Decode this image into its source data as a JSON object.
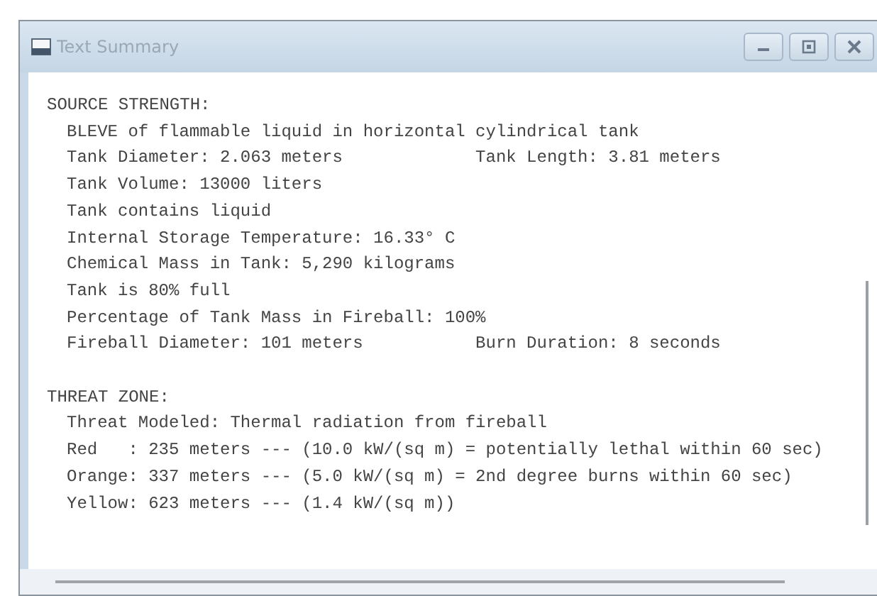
{
  "window": {
    "title": "Text Summary",
    "controls": [
      {
        "kind": "minimize"
      },
      {
        "kind": "restore"
      },
      {
        "kind": "close"
      }
    ]
  },
  "sections": [
    {
      "heading": "SOURCE STRENGTH:",
      "lines": [
        {
          "text": "BLEVE of flammable liquid in horizontal cylindrical tank"
        },
        {
          "text": "Tank Diameter: 2.063 meters",
          "second": "Tank Length: 3.81 meters"
        },
        {
          "text": "Tank Volume: 13000 liters"
        },
        {
          "text": "Tank contains liquid"
        },
        {
          "text": "Internal Storage Temperature: 16.33° C"
        },
        {
          "text": "Chemical Mass in Tank: 5,290 kilograms"
        },
        {
          "text": "Tank is 80% full"
        },
        {
          "text": "Percentage of Tank Mass in Fireball: 100%"
        },
        {
          "text": "Fireball Diameter: 101 meters",
          "second": "Burn Duration: 8 seconds"
        }
      ]
    },
    {
      "heading": "THREAT ZONE:",
      "lines": [
        {
          "text": "Threat Modeled: Thermal radiation from fireball"
        },
        {
          "text": "Red   : 235 meters --- (10.0 kW/(sq m) = potentially lethal within 60 sec)"
        },
        {
          "text": "Orange: 337 meters --- (5.0 kW/(sq m) = 2nd degree burns within 60 sec)"
        },
        {
          "text": "Yellow: 623 meters --- (1.4 kW/(sq m))"
        }
      ]
    }
  ]
}
